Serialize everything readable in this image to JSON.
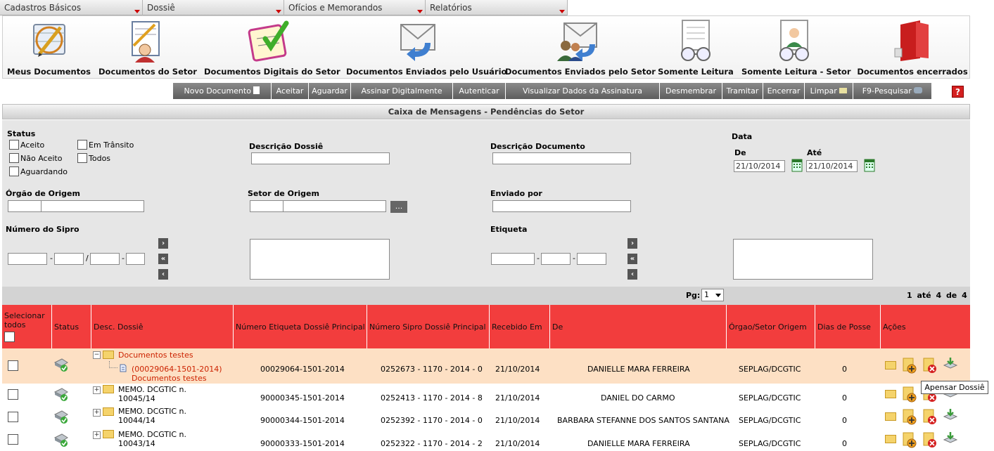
{
  "menu": [
    "Cadastros Básicos",
    "Dossiê",
    "Ofícios e Memorandos",
    "Relatórios"
  ],
  "toolbar": [
    {
      "label": "Meus Documentos",
      "icon": "clock-pen-icon"
    },
    {
      "label": "Documentos do Setor",
      "icon": "person-notepad-icon"
    },
    {
      "label": "Documentos Digitais do Setor",
      "icon": "checklist-icon"
    },
    {
      "label": "Documentos Enviados pelo Usuário",
      "icon": "envelope-return-icon"
    },
    {
      "label": "Documentos Enviados pelo Setor",
      "icon": "envelope-users-icon"
    },
    {
      "label": "Somente Leitura",
      "icon": "reading-glasses-icon"
    },
    {
      "label": "Somente Leitura - Setor",
      "icon": "reading-person-icon"
    },
    {
      "label": "Documentos encerrados",
      "icon": "red-binder-icon"
    }
  ],
  "actions": [
    "Novo Documento",
    "Aceitar",
    "Aguardar",
    "Assinar Digitalmente",
    "Autenticar",
    "Visualizar Dados da Assinatura",
    "Desmembrar",
    "Tramitar",
    "Encerrar",
    "Limpar",
    "F9-Pesquisar"
  ],
  "help": "?",
  "caixa_title": "Caixa de Mensagens - Pendências do Setor",
  "filters": {
    "status_label": "Status",
    "status_options": [
      "Aceito",
      "Em Trânsito",
      "Não Aceito",
      "Todos",
      "Aguardando"
    ],
    "descricao_dossie": "Descrição Dossiê",
    "descricao_documento": "Descrição Documento",
    "data": "Data",
    "de": "De",
    "ate": "Até",
    "de_value": "21/10/2014",
    "ate_value": "21/10/2014",
    "orgao_origem": "Órgão de Origem",
    "setor_origem": "Setor de Origem",
    "enviado_por": "Enviado por",
    "numero_sipro": "Número do Sipro",
    "etiqueta": "Etiqueta",
    "dots": "...",
    "dash": "-",
    "slash": "/",
    "btn_next": "›",
    "btn_all": "«",
    "btn_prev": "‹"
  },
  "pager": {
    "pg_label": "Pg:",
    "pg_value": "1",
    "range": "1 até 4 de 4"
  },
  "columns": [
    "Selecionar todos",
    "Status",
    "Desc. Dossiê",
    "Número Etiqueta Dossiê Principal",
    "Número Sipro Dossiê Principal",
    "Recebido Em",
    "De",
    "Órgao/Setor Origem",
    "Dias de Posse",
    "Ações"
  ],
  "rows": [
    {
      "dossie": "Documentos testes",
      "sub": "(00029064-1501-2014)",
      "sub2": "Documentos testes",
      "etiqueta": "00029064-1501-2014",
      "sipro": "0252673 - 1170 - 2014 - 0",
      "recebido": "21/10/2014",
      "de": "DANIELLE MARA FERREIRA",
      "orgao": "SEPLAG/DCGTIC",
      "dias": "0"
    },
    {
      "dossie": "MEMO. DCGTIC n.",
      "dossie2": "10045/14",
      "etiqueta": "90000345-1501-2014",
      "sipro": "0252413 - 1170 - 2014 - 8",
      "recebido": "21/10/2014",
      "de": "DANIEL DO CARMO",
      "orgao": "SEPLAG/DCGTIC",
      "dias": "0"
    },
    {
      "dossie": "MEMO. DCGTIC n.",
      "dossie2": "10044/14",
      "etiqueta": "90000344-1501-2014",
      "sipro": "0252392 - 1170 - 2014 - 0",
      "recebido": "21/10/2014",
      "de": "BARBARA STEFANNE DOS SANTOS SANTANA",
      "orgao": "SEPLAG/DCGTIC",
      "dias": "0"
    },
    {
      "dossie": "MEMO. DCGTIC n.",
      "dossie2": "10043/14",
      "etiqueta": "90000333-1501-2014",
      "sipro": "0252322 - 1170 - 2014 - 2",
      "recebido": "21/10/2014",
      "de": "DANIELLE MARA FERREIRA",
      "orgao": "SEPLAG/DCGTIC",
      "dias": "0"
    }
  ],
  "tooltip": "Apensar Dossiê",
  "colors": {
    "header_red": "#f23d3d",
    "highlight_row": "#fde0c4",
    "link_red": "#cc2200"
  }
}
